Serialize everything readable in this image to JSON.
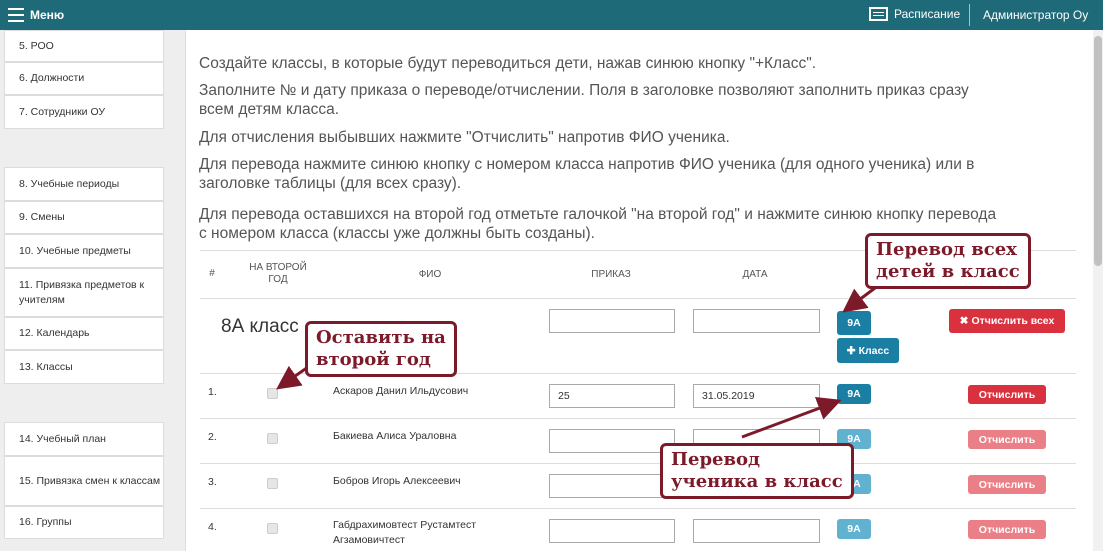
{
  "topbar": {
    "menu_label": "Меню",
    "schedule_label": "Расписание",
    "user_label": "Администратор Оу"
  },
  "sidebar": {
    "group1": [
      "5. РОО",
      "6. Должности",
      "7. Сотрудники ОУ"
    ],
    "group2": [
      "8. Учебные периоды",
      "9. Смены",
      "10. Учебные предметы",
      "11. Привязка предметов к учителям",
      "12. Календарь",
      "13. Классы"
    ],
    "group3": [
      "14. Учебный план",
      "15. Привязка смен к классам",
      "16. Группы"
    ]
  },
  "instructions": {
    "p1": "Создайте классы, в которые будут переводиться дети, нажав синюю кнопку \"+Класс\".",
    "p2a": "Заполните № и дату приказа о переводе/отчислении. Поля в заголовке позволяют заполнить приказ сразу",
    "p2b": "всем детям класса.",
    "p3": "Для отчисления выбывших нажмите \"Отчислить\" напротив ФИО ученика.",
    "p4a": "Для перевода нажмите синюю кнопку с номером класса напротив ФИО ученика (для одного ученика) или в",
    "p4b": "заголовке таблицы (для всех сразу).",
    "p5a": "Для перевода оставшихся на второй год отметьте галочкой \"на второй год\" и нажмите синюю кнопку перевода",
    "p5b": "с номером класса (классы уже должны быть созданы)."
  },
  "table": {
    "headers": {
      "num": "#",
      "second_year_1": "НА ВТОРОЙ",
      "second_year_2": "ГОД",
      "fio": "ФИО",
      "order": "ПРИКАЗ",
      "date": "ДАТА"
    },
    "class_row": {
      "title": "8А класс",
      "transfer_label": "9А",
      "add_class_label": "Класс",
      "expel_all_label": "Отчислить всех"
    },
    "rows": [
      {
        "num": "1.",
        "name1": "Аскаров Данил Ильдусович",
        "name2": "",
        "order": "25",
        "date": "31.05.2019",
        "transfer": "9А",
        "expel": "Отчислить"
      },
      {
        "num": "2.",
        "name1": "Бакиева Алиса Ураловна",
        "name2": "",
        "order": "",
        "date": "",
        "transfer": "9А",
        "expel": "Отчислить"
      },
      {
        "num": "3.",
        "name1": "Бобров Игорь Алексеевич",
        "name2": "",
        "order": "",
        "date": "",
        "transfer": "9А",
        "expel": "Отчислить"
      },
      {
        "num": "4.",
        "name1": "Габдрахимовтест Рустамтест",
        "name2": "Агзамовичтест",
        "order": "",
        "date": "",
        "transfer": "9А",
        "expel": "Отчислить"
      }
    ]
  },
  "callouts": {
    "transfer_all_1": "Перевод всех",
    "transfer_all_2": "детей в класс",
    "leave_1": "Оставить на",
    "leave_2": "второй год",
    "transfer_one_1": "Перевод",
    "transfer_one_2": "ученика в класс"
  },
  "colors": {
    "topbar": "#1f6a78",
    "primary": "#1a7fa2",
    "danger": "#d9313e",
    "callout": "#7d1a2a"
  }
}
